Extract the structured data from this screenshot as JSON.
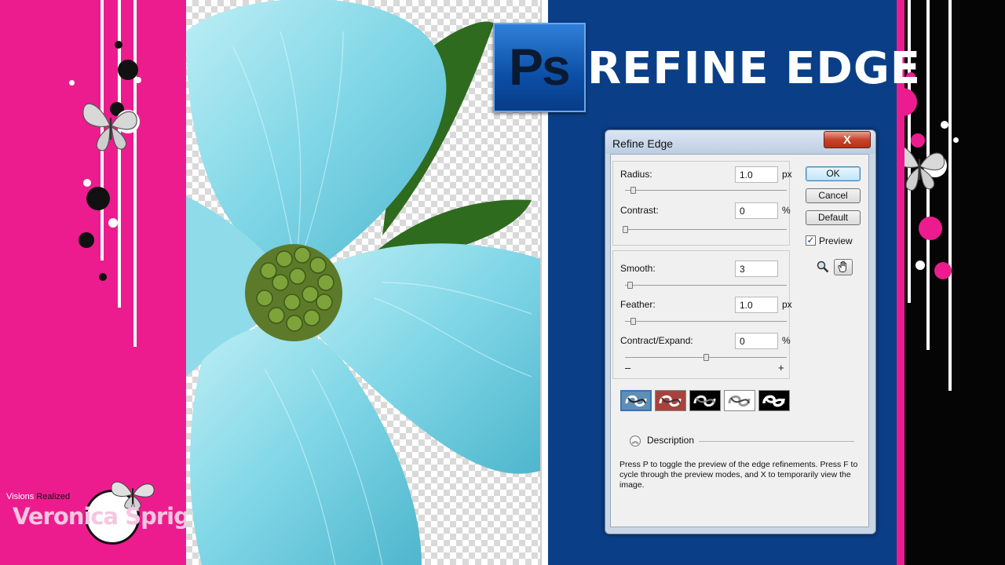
{
  "headline": {
    "logo": "Ps",
    "title": "REFINE EDGE"
  },
  "branding": {
    "tagline_a": "Visions",
    "tagline_b": "Realized",
    "name": "Veronica Spriggs"
  },
  "dialog": {
    "title": "Refine Edge",
    "close_symbol": "X",
    "fields": [
      {
        "label": "Radius:",
        "value": "1.0",
        "unit": "px",
        "slider_fraction": 0.05
      },
      {
        "label": "Contrast:",
        "value": "0",
        "unit": "%",
        "slider_fraction": 0.0
      },
      {
        "label": "Smooth:",
        "value": "3",
        "unit": "",
        "slider_fraction": 0.03
      },
      {
        "label": "Feather:",
        "value": "1.0",
        "unit": "px",
        "slider_fraction": 0.05
      },
      {
        "label": "Contract/Expand:",
        "value": "0",
        "unit": "%",
        "slider_fraction": 0.5
      }
    ],
    "minus_symbol": "–",
    "plus_symbol": "+",
    "buttons": {
      "ok": "OK",
      "cancel": "Cancel",
      "default": "Default"
    },
    "preview": {
      "label": "Preview",
      "checked": true
    },
    "tools": [
      "zoom-icon",
      "hand-icon"
    ],
    "preview_modes": [
      "standard-mode",
      "quick-mask-mode",
      "on-black-mode",
      "on-white-mode",
      "mask-mode"
    ],
    "description": {
      "heading": "Description",
      "text": "Press P to toggle the preview of the edge refinements. Press F to cycle through the preview modes, and X to temporarily view the image."
    }
  },
  "colors": {
    "pink": "#ec1c8f",
    "blue": "#0a3f88",
    "flower": "#7fd6e6"
  }
}
